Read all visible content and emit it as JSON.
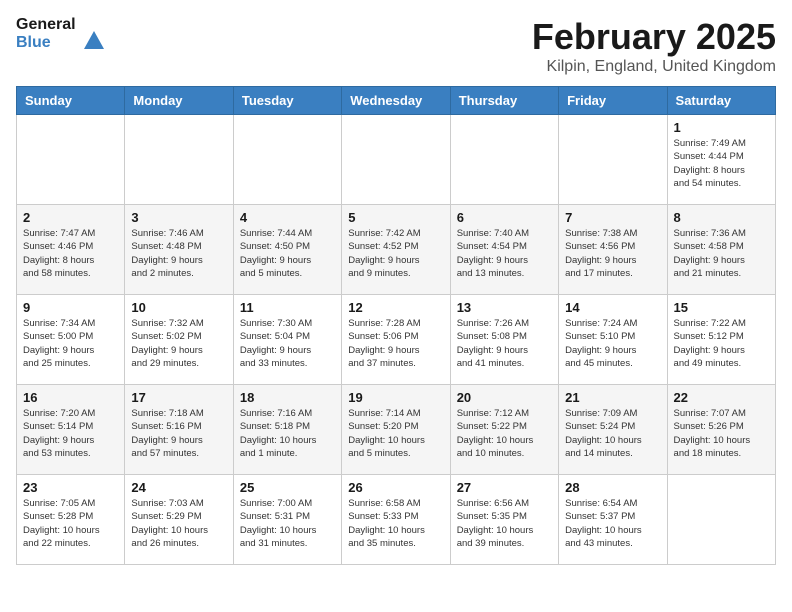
{
  "header": {
    "logo_line1": "General",
    "logo_line2": "Blue",
    "title": "February 2025",
    "subtitle": "Kilpin, England, United Kingdom"
  },
  "weekdays": [
    "Sunday",
    "Monday",
    "Tuesday",
    "Wednesday",
    "Thursday",
    "Friday",
    "Saturday"
  ],
  "weeks": [
    [
      {
        "day": "",
        "info": ""
      },
      {
        "day": "",
        "info": ""
      },
      {
        "day": "",
        "info": ""
      },
      {
        "day": "",
        "info": ""
      },
      {
        "day": "",
        "info": ""
      },
      {
        "day": "",
        "info": ""
      },
      {
        "day": "1",
        "info": "Sunrise: 7:49 AM\nSunset: 4:44 PM\nDaylight: 8 hours\nand 54 minutes."
      }
    ],
    [
      {
        "day": "2",
        "info": "Sunrise: 7:47 AM\nSunset: 4:46 PM\nDaylight: 8 hours\nand 58 minutes."
      },
      {
        "day": "3",
        "info": "Sunrise: 7:46 AM\nSunset: 4:48 PM\nDaylight: 9 hours\nand 2 minutes."
      },
      {
        "day": "4",
        "info": "Sunrise: 7:44 AM\nSunset: 4:50 PM\nDaylight: 9 hours\nand 5 minutes."
      },
      {
        "day": "5",
        "info": "Sunrise: 7:42 AM\nSunset: 4:52 PM\nDaylight: 9 hours\nand 9 minutes."
      },
      {
        "day": "6",
        "info": "Sunrise: 7:40 AM\nSunset: 4:54 PM\nDaylight: 9 hours\nand 13 minutes."
      },
      {
        "day": "7",
        "info": "Sunrise: 7:38 AM\nSunset: 4:56 PM\nDaylight: 9 hours\nand 17 minutes."
      },
      {
        "day": "8",
        "info": "Sunrise: 7:36 AM\nSunset: 4:58 PM\nDaylight: 9 hours\nand 21 minutes."
      }
    ],
    [
      {
        "day": "9",
        "info": "Sunrise: 7:34 AM\nSunset: 5:00 PM\nDaylight: 9 hours\nand 25 minutes."
      },
      {
        "day": "10",
        "info": "Sunrise: 7:32 AM\nSunset: 5:02 PM\nDaylight: 9 hours\nand 29 minutes."
      },
      {
        "day": "11",
        "info": "Sunrise: 7:30 AM\nSunset: 5:04 PM\nDaylight: 9 hours\nand 33 minutes."
      },
      {
        "day": "12",
        "info": "Sunrise: 7:28 AM\nSunset: 5:06 PM\nDaylight: 9 hours\nand 37 minutes."
      },
      {
        "day": "13",
        "info": "Sunrise: 7:26 AM\nSunset: 5:08 PM\nDaylight: 9 hours\nand 41 minutes."
      },
      {
        "day": "14",
        "info": "Sunrise: 7:24 AM\nSunset: 5:10 PM\nDaylight: 9 hours\nand 45 minutes."
      },
      {
        "day": "15",
        "info": "Sunrise: 7:22 AM\nSunset: 5:12 PM\nDaylight: 9 hours\nand 49 minutes."
      }
    ],
    [
      {
        "day": "16",
        "info": "Sunrise: 7:20 AM\nSunset: 5:14 PM\nDaylight: 9 hours\nand 53 minutes."
      },
      {
        "day": "17",
        "info": "Sunrise: 7:18 AM\nSunset: 5:16 PM\nDaylight: 9 hours\nand 57 minutes."
      },
      {
        "day": "18",
        "info": "Sunrise: 7:16 AM\nSunset: 5:18 PM\nDaylight: 10 hours\nand 1 minute."
      },
      {
        "day": "19",
        "info": "Sunrise: 7:14 AM\nSunset: 5:20 PM\nDaylight: 10 hours\nand 5 minutes."
      },
      {
        "day": "20",
        "info": "Sunrise: 7:12 AM\nSunset: 5:22 PM\nDaylight: 10 hours\nand 10 minutes."
      },
      {
        "day": "21",
        "info": "Sunrise: 7:09 AM\nSunset: 5:24 PM\nDaylight: 10 hours\nand 14 minutes."
      },
      {
        "day": "22",
        "info": "Sunrise: 7:07 AM\nSunset: 5:26 PM\nDaylight: 10 hours\nand 18 minutes."
      }
    ],
    [
      {
        "day": "23",
        "info": "Sunrise: 7:05 AM\nSunset: 5:28 PM\nDaylight: 10 hours\nand 22 minutes."
      },
      {
        "day": "24",
        "info": "Sunrise: 7:03 AM\nSunset: 5:29 PM\nDaylight: 10 hours\nand 26 minutes."
      },
      {
        "day": "25",
        "info": "Sunrise: 7:00 AM\nSunset: 5:31 PM\nDaylight: 10 hours\nand 31 minutes."
      },
      {
        "day": "26",
        "info": "Sunrise: 6:58 AM\nSunset: 5:33 PM\nDaylight: 10 hours\nand 35 minutes."
      },
      {
        "day": "27",
        "info": "Sunrise: 6:56 AM\nSunset: 5:35 PM\nDaylight: 10 hours\nand 39 minutes."
      },
      {
        "day": "28",
        "info": "Sunrise: 6:54 AM\nSunset: 5:37 PM\nDaylight: 10 hours\nand 43 minutes."
      },
      {
        "day": "",
        "info": ""
      }
    ]
  ]
}
